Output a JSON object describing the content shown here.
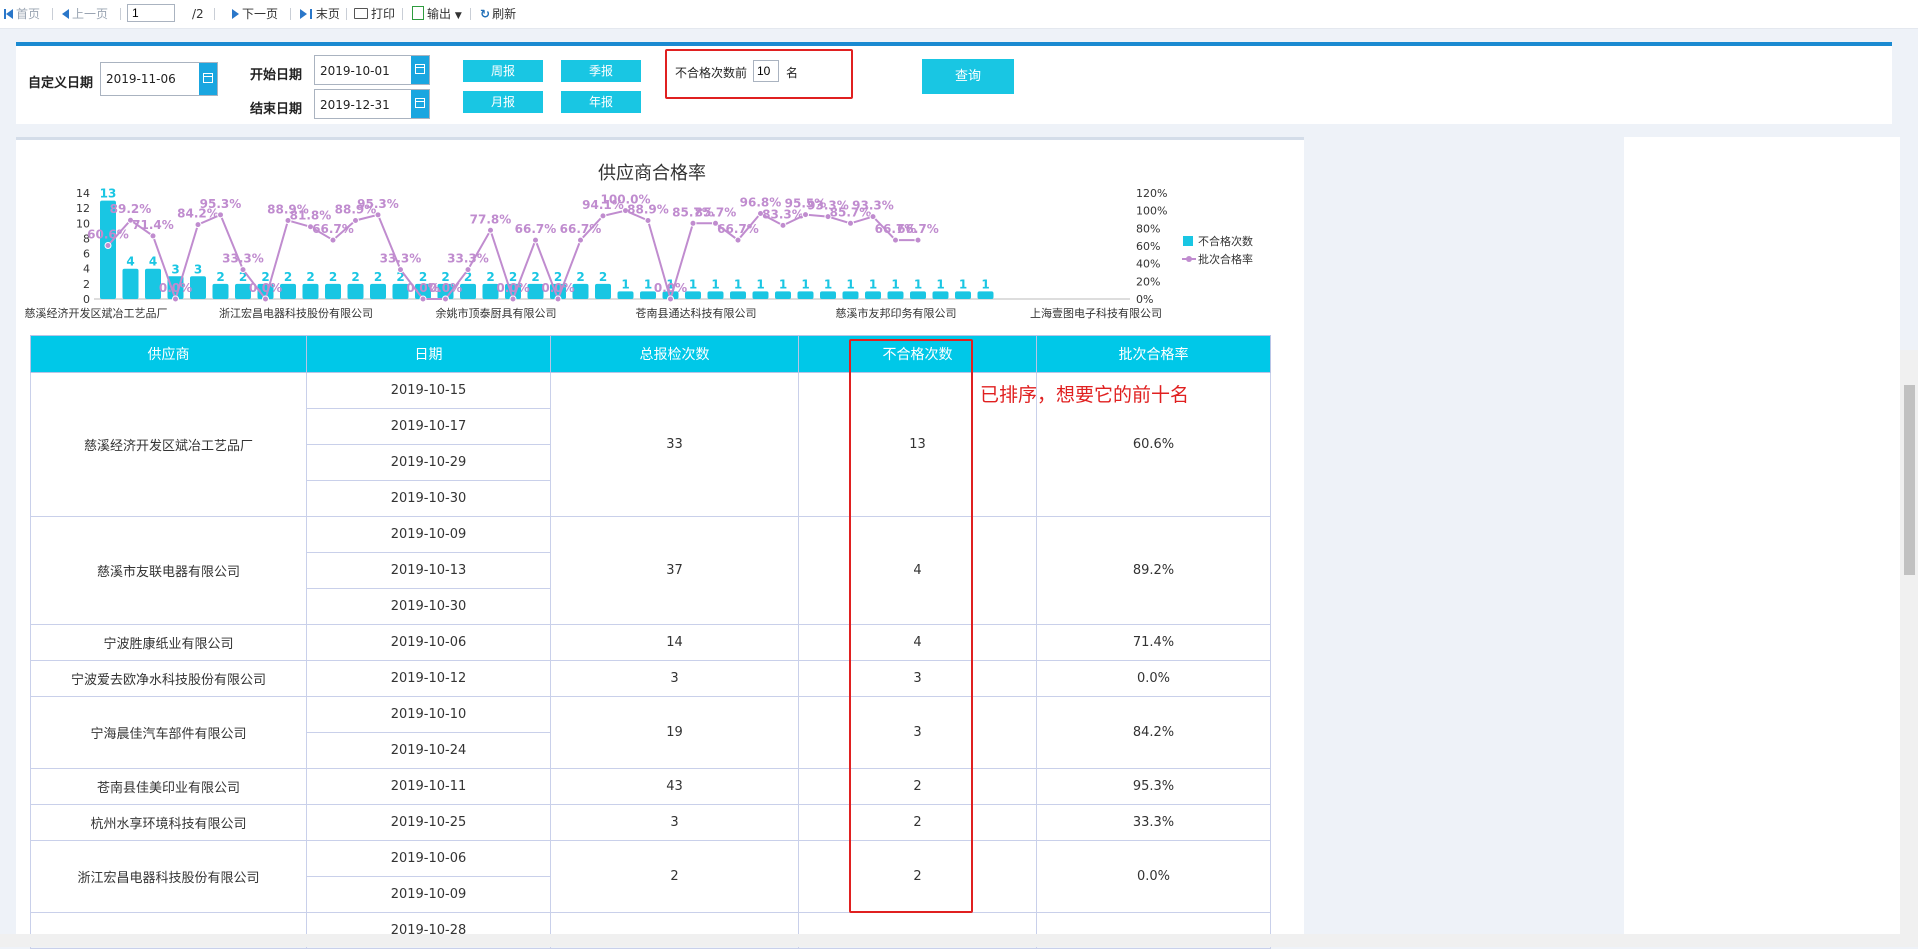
{
  "toolbar": {
    "first": "首页",
    "prev": "上一页",
    "page_value": "1",
    "page_total": "/2",
    "next": "下一页",
    "last": "末页",
    "print": "打印",
    "export": "输出",
    "refresh": "刷新"
  },
  "filter": {
    "custom_date_label": "自定义日期",
    "custom_date_value": "2019-11-06",
    "start_label": "开始日期",
    "start_value": "2019-10-01",
    "end_label": "结束日期",
    "end_value": "2019-12-31",
    "weekly": "周报",
    "quarterly": "季报",
    "monthly": "月报",
    "yearly": "年报",
    "topn_prefix": "不合格次数前",
    "topn_value": "10",
    "topn_suffix": "名",
    "query": "查询"
  },
  "colors": {
    "accent": "#19c6e3",
    "line": "#c08ccf",
    "annotation": "#e02020"
  },
  "chart_data": {
    "type": "bar",
    "title": "供应商合格率",
    "series": [
      {
        "name": "不合格次数",
        "values": [
          13,
          4,
          4,
          3,
          3,
          2,
          2,
          2,
          2,
          2,
          2,
          2,
          2,
          2,
          2,
          2,
          2,
          2,
          2,
          2,
          2,
          2,
          2,
          1,
          1,
          1,
          1,
          1,
          1,
          1,
          1,
          1,
          1,
          1,
          1,
          1,
          1,
          1,
          1,
          1
        ]
      },
      {
        "name": "批次合格率",
        "values": [
          60.6,
          89.2,
          71.4,
          0.0,
          84.2,
          95.3,
          33.3,
          0.0,
          88.9,
          81.8,
          66.7,
          88.9,
          95.3,
          33.3,
          0.0,
          0.0,
          33.3,
          77.8,
          0.0,
          66.7,
          0.0,
          66.7,
          94.1,
          100.0,
          88.9,
          0.0,
          85.7,
          85.7,
          66.7,
          96.8,
          83.3,
          95.5,
          93.3,
          85.7,
          93.3,
          66.7,
          66.7
        ]
      }
    ],
    "bar_labels": [
      "13",
      "4",
      "4",
      "3",
      "3",
      "2",
      "2",
      "2",
      "2",
      "2",
      "2",
      "2",
      "2",
      "2",
      "2",
      "2",
      "2",
      "2",
      "2",
      "2",
      "2",
      "2",
      "2",
      "1",
      "1",
      "1",
      "1",
      "1",
      "1",
      "1",
      "1",
      "1",
      "1",
      "1",
      "1",
      "1",
      "1",
      "1",
      "1",
      "1"
    ],
    "line_labels": [
      "60.6%",
      "89.2%",
      "71.4%",
      "0.0%",
      "84.2%",
      "95.3%",
      "33.3%",
      "0.0%",
      "88.9%",
      "81.8%",
      "66.7%",
      "88.9%",
      "95.3%",
      "33.3%",
      "0.0%",
      "0.0%",
      "33.3%",
      "77.8%",
      "0.0%",
      "66.7%",
      "0.0%",
      "66.7%",
      "94.1%",
      "100.0%",
      "88.9%",
      "0.0%",
      "85.7%",
      "85.7%",
      "66.7%",
      "96.8%",
      "83.3%",
      "95.5%",
      "93.3%",
      "85.7%",
      "93.3%",
      "66.7%",
      "66.7%"
    ],
    "y_ticks": [
      "0",
      "2",
      "4",
      "6",
      "8",
      "10",
      "12",
      "14"
    ],
    "y2_ticks": [
      "0%",
      "20%",
      "40%",
      "60%",
      "80%",
      "100%",
      "120%"
    ],
    "x_labels": [
      "慈溪经济开发区斌冶工艺品厂",
      "浙江宏昌电器科技股份有限公司",
      "余姚市顶泰厨具有限公司",
      "苍南县通达科技有限公司",
      "慈溪市友邦印务有限公司",
      "上海壹图电子科技有限公司"
    ],
    "ylim": [
      0,
      14
    ],
    "y2lim": [
      0,
      120
    ],
    "legend_position": "right"
  },
  "table": {
    "headers": [
      "供应商",
      "日期",
      "总报检次数",
      "不合格次数",
      "批次合格率"
    ],
    "groups": [
      {
        "supplier": "慈溪经济开发区斌冶工艺品厂",
        "dates": [
          "2019-10-15",
          "2019-10-17",
          "2019-10-29",
          "2019-10-30"
        ],
        "total": "33",
        "fail": "13",
        "rate": "60.6%"
      },
      {
        "supplier": "慈溪市友联电器有限公司",
        "dates": [
          "2019-10-09",
          "2019-10-13",
          "2019-10-30"
        ],
        "total": "37",
        "fail": "4",
        "rate": "89.2%"
      },
      {
        "supplier": "宁波胜康纸业有限公司",
        "dates": [
          "2019-10-06"
        ],
        "total": "14",
        "fail": "4",
        "rate": "71.4%"
      },
      {
        "supplier": "宁波爱去欧净水科技股份有限公司",
        "dates": [
          "2019-10-12"
        ],
        "total": "3",
        "fail": "3",
        "rate": "0.0%"
      },
      {
        "supplier": "宁海晨佳汽车部件有限公司",
        "dates": [
          "2019-10-10",
          "2019-10-24"
        ],
        "total": "19",
        "fail": "3",
        "rate": "84.2%"
      },
      {
        "supplier": "苍南县佳美印业有限公司",
        "dates": [
          "2019-10-11"
        ],
        "total": "43",
        "fail": "2",
        "rate": "95.3%"
      },
      {
        "supplier": "杭州水享环境科技有限公司",
        "dates": [
          "2019-10-25"
        ],
        "total": "3",
        "fail": "2",
        "rate": "33.3%"
      },
      {
        "supplier": "浙江宏昌电器科技股份有限公司",
        "dates": [
          "2019-10-06",
          "2019-10-09"
        ],
        "total": "2",
        "fail": "2",
        "rate": "0.0%"
      },
      {
        "supplier": "",
        "dates": [
          "2019-10-28"
        ],
        "total": "",
        "fail": "",
        "rate": ""
      }
    ]
  },
  "annotation": "已排序，想要它的前十名"
}
